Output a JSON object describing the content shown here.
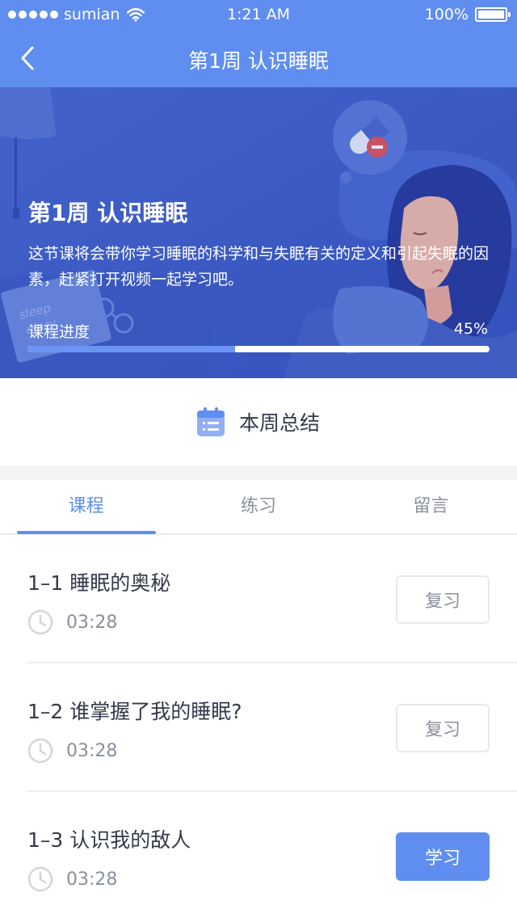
{
  "status_bar": {
    "carrier": "sumian",
    "time": "1:21 AM",
    "battery": "100%"
  },
  "nav": {
    "title": "第1周  认识睡眠",
    "back_icon": "chevron-left-icon"
  },
  "hero": {
    "title": "第1周  认识睡眠",
    "description": "这节课将会带你学习睡眠的科学和与失眠有关的定义和引起失眠的因素，赶紧打开视频一起学习吧。",
    "progress_label": "课程进度",
    "progress_text": "45%",
    "progress_value": 0.45,
    "illustration_notebook_text": "sleep diary"
  },
  "summary": {
    "label": "本周总结",
    "icon": "calendar-list-icon"
  },
  "tabs": [
    {
      "label": "课程",
      "active": true
    },
    {
      "label": "练习",
      "active": false
    },
    {
      "label": "留言",
      "active": false
    }
  ],
  "lessons": [
    {
      "title": "1–1 睡眠的奥秘",
      "duration": "03:28",
      "action": "复习",
      "style": "outline"
    },
    {
      "title": "1–2 谁掌握了我的睡眠?",
      "duration": "03:28",
      "action": "复习",
      "style": "outline"
    },
    {
      "title": "1–3 认识我的敌人",
      "duration": "03:28",
      "action": "学习",
      "style": "primary"
    }
  ],
  "colors": {
    "accent": "#5f8ef0",
    "hero_bg": "#3f5fcb",
    "text_primary": "#333a4a",
    "text_secondary": "#8a909c"
  }
}
